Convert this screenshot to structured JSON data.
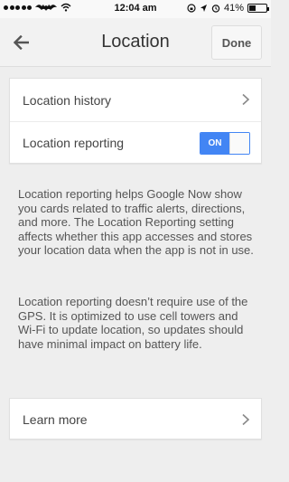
{
  "status_bar": {
    "time": "12:04 am",
    "battery_text": "41%",
    "battery_level": 0.41
  },
  "header": {
    "title": "Location",
    "done_label": "Done"
  },
  "settings": {
    "location_history_label": "Location history",
    "location_reporting_label": "Location reporting",
    "toggle_text": "ON"
  },
  "info": {
    "paragraph1": "Location reporting helps Google Now show you cards related to traffic alerts, directions, and more. The Location Reporting setting affects whether this app accesses and stores your location data when the app is not in use.",
    "paragraph2": "Location reporting doesn’t require use of the GPS. It is optimized to use cell towers and Wi-Fi to update location, so updates should have minimal impact on battery life."
  },
  "learn_more_label": "Learn more",
  "colors": {
    "accent": "#4285f4",
    "background": "#eeeeee"
  }
}
